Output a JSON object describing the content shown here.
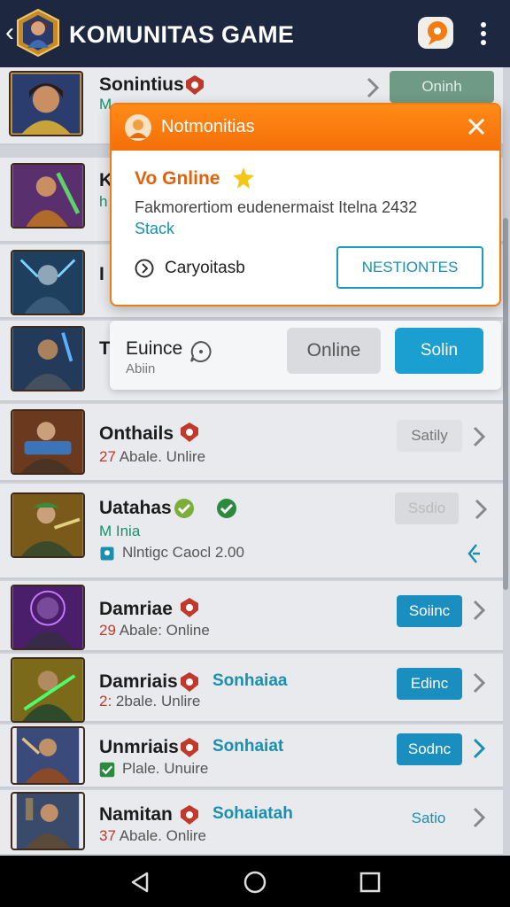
{
  "appbar": {
    "title": "KOMUNITAS GAME",
    "back_icon": "chevron-left-icon",
    "chat_icon": "chat-bubble-icon",
    "more_icon": "more-vert-icon"
  },
  "rows": [
    {
      "name": "Sonintius",
      "status_prefix": "",
      "status": "M",
      "button": "Oninh"
    },
    {
      "name": "K",
      "status_prefix": "",
      "status": "h",
      "button": ""
    },
    {
      "name": "I",
      "status_prefix": "",
      "status": "",
      "button": ""
    },
    {
      "name": "T",
      "status_prefix": "",
      "status": "",
      "button": ""
    },
    {
      "name": "Onthails",
      "status_prefix": "27",
      "status": "Abale. Unlire",
      "button": "Satily"
    },
    {
      "name": "Uatahas",
      "status_prefix": "",
      "status": "M Inia",
      "extra": "Nlntigc Caocl 2.00",
      "button": "Ssdio"
    },
    {
      "name": "Damriae",
      "status_prefix": "29",
      "status": "Abale: Online",
      "button": "Soiinc"
    },
    {
      "name": "Damriais",
      "status_prefix": "2:",
      "status": "2bale. Unlire",
      "teal": "Sonhaiaa",
      "button": "Edinc"
    },
    {
      "name": "Unmriais",
      "status_prefix": "",
      "status": "Plale. Unuire",
      "teal": "Sonhaiat",
      "button": "Sodnc"
    },
    {
      "name": "Namitan",
      "status_prefix": "37",
      "status": "Abale. Onlire",
      "teal": "Sohaiatah",
      "button": "Satio"
    }
  ],
  "popup": {
    "title": "Notmonitias",
    "subtitle": "Vo Gnline",
    "message": "Fakmorertiom eudenermaist Itelna 2432",
    "link": "Stack",
    "option": "Caryoitasb",
    "action": "NESTIONTES"
  },
  "card2": {
    "name": "Euince",
    "status": "Abiin",
    "online_button": "Online",
    "primary_button": "Solin"
  },
  "colors": {
    "appbar": "#1d2740",
    "accent_orange": "#f47a10",
    "accent_blue": "#1b8ec0",
    "online_green": "#2b8a3e"
  }
}
